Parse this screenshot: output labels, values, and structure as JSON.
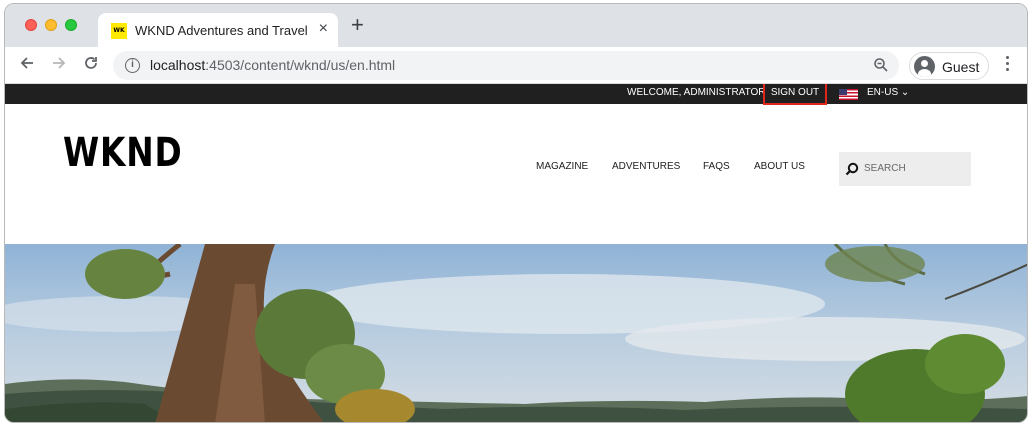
{
  "browser": {
    "tab_title": "WKND Adventures and Travel",
    "favicon_text": "WK",
    "url_host": "localhost",
    "url_path": ":4503/content/wknd/us/en.html",
    "profile_label": "Guest",
    "icons": [
      "back-arrow-icon",
      "forward-arrow-icon",
      "reload-icon",
      "info-icon",
      "zoom-icon",
      "close-icon",
      "plus-icon",
      "menu-dots-icon"
    ]
  },
  "site": {
    "topbar": {
      "welcome": "WELCOME, ADMINISTRATOR",
      "sign_out": "SIGN OUT",
      "language": "EN-US",
      "highlight_color": "#e0251b"
    },
    "logo": "WKND",
    "nav": [
      "MAGAZINE",
      "ADVENTURES",
      "FAQS",
      "ABOUT US"
    ],
    "search_placeholder": "SEARCH"
  }
}
